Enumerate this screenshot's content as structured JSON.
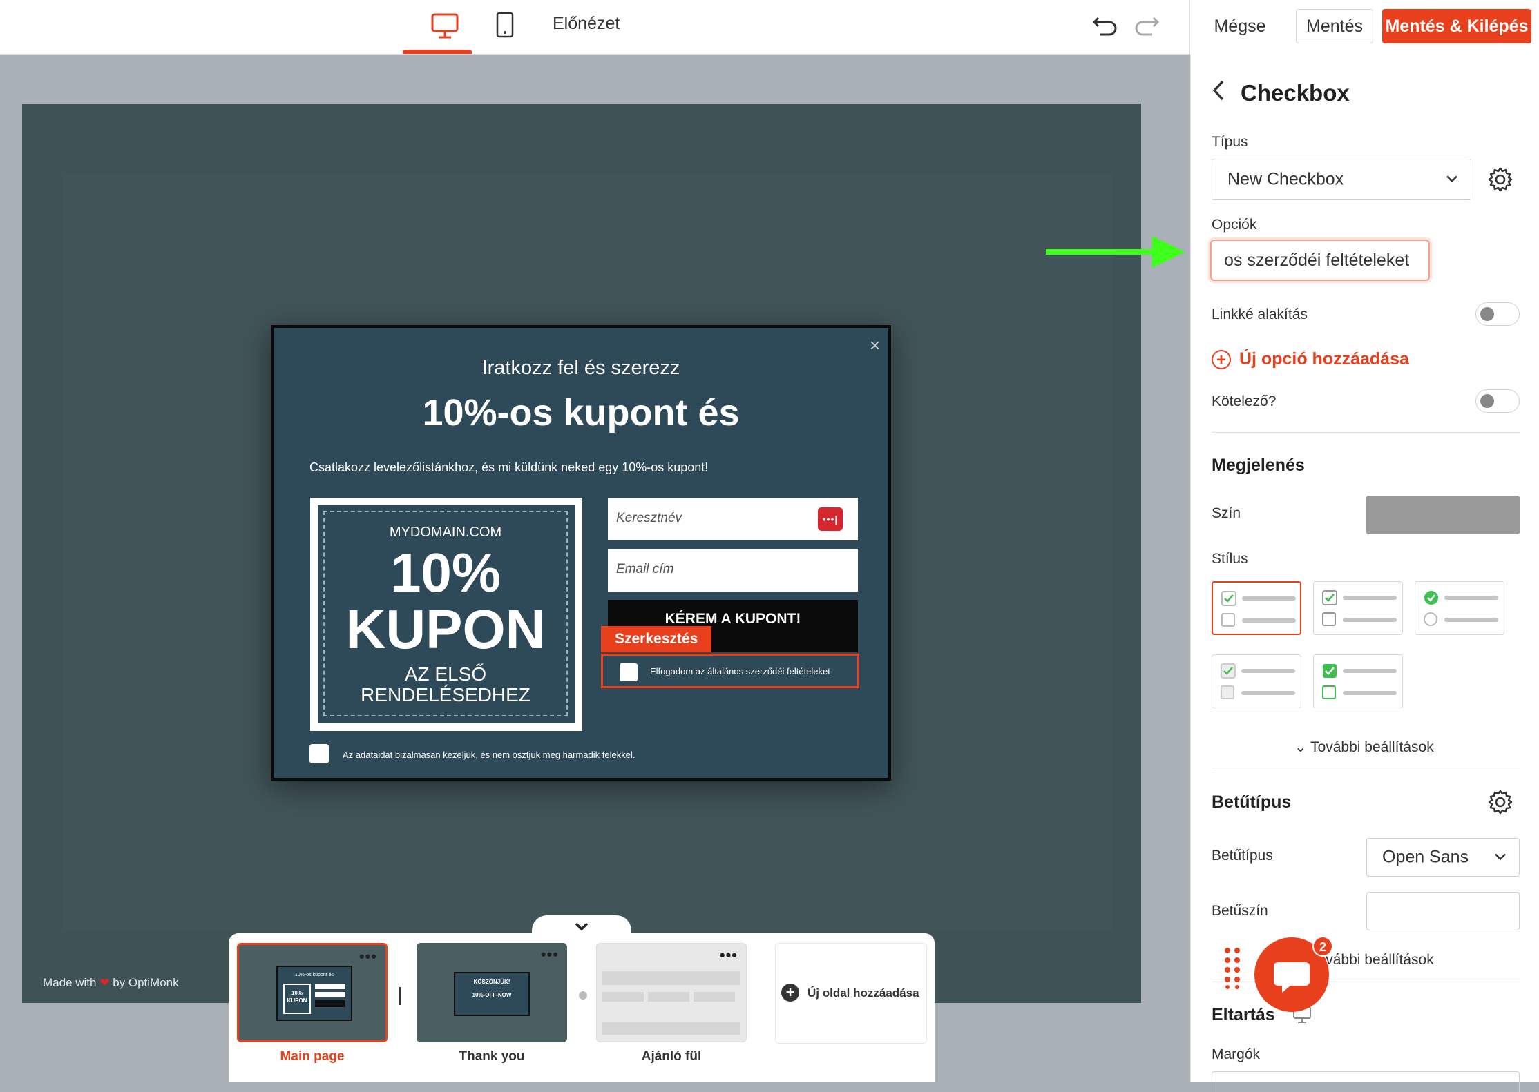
{
  "topbar": {
    "preview_label": "Előnézet",
    "cancel_label": "Mégse",
    "save_label": "Mentés",
    "save_exit_label": "Mentés & Kilépés"
  },
  "popup": {
    "subtitle": "Iratkozz fel és szerezz",
    "title": "10%-os kupont és",
    "description": "Csatlakozz levelezőlistánkhoz, és mi küldünk neked egy 10%-os kupont!",
    "coupon": {
      "domain": "MYDOMAIN.COM",
      "percent": "10%",
      "kupon": "KUPON",
      "line1": "AZ ELSŐ",
      "line2": "RENDELÉSEDHEZ"
    },
    "first_name_placeholder": "Keresztnév",
    "email_placeholder": "Email cím",
    "cta_label": "KÉREM A KUPONT!",
    "edit_badge": "Szerkesztés",
    "checkbox_label": "Elfogadom az általános szerződéi feltételeket",
    "privacy_label": "Az adataidat bizalmasan kezeljük, és nem osztjuk meg harmadik felekkel."
  },
  "canvas": {
    "made_with": "Made with",
    "by": "by OptiMonk"
  },
  "pages": {
    "items": [
      {
        "label": "Main page",
        "active": true
      },
      {
        "label": "Thank you",
        "active": false
      },
      {
        "label": "Ajánló fül",
        "active": false
      }
    ],
    "add_label": "Új oldal hozzáadása",
    "thumb_main_text": [
      "10%-os kupont és",
      "10%",
      "KUPON"
    ],
    "thumb_ty_text": [
      "KÖSZÖNJÜK!",
      "10%-OFF-NOW"
    ]
  },
  "panel": {
    "title": "Checkbox",
    "type_label": "Típus",
    "type_value": "New Checkbox",
    "options_label": "Opciók",
    "option_value": "os szerződéi feltételeket",
    "linkify_label": "Linkké alakítás",
    "add_option_label": "Új opció hozzáadása",
    "required_label": "Kötelező?",
    "appearance_heading": "Megjelenés",
    "color_label": "Szín",
    "style_label": "Stílus",
    "more_settings": "További beállítások",
    "font_heading": "Betűtípus",
    "font_label": "Betűtípus",
    "font_value": "Open Sans",
    "font_color_label": "Betűszín",
    "offset_heading": "Eltartás",
    "margins_label": "Margók",
    "chat_badge": "2"
  },
  "colors": {
    "accent": "#e8401c",
    "popup_bg": "#2e4958",
    "canvas_bg": "#3f5357",
    "check_green": "#3fbf4f",
    "annotation_arrow": "#3dff1a"
  }
}
